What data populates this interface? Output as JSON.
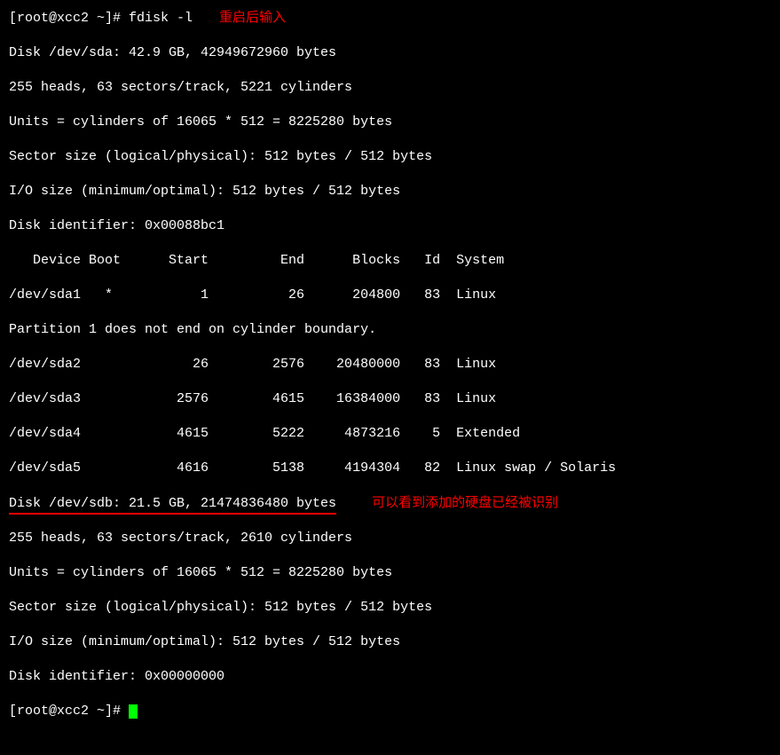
{
  "prompt": {
    "user_host": "[root@xcc2 ~]# ",
    "command": "fdisk -l",
    "annotation1": "重启后输入"
  },
  "disk_sda": {
    "header": "Disk /dev/sda: 42.9 GB, 42949672960 bytes",
    "geometry": "255 heads, 63 sectors/track, 5221 cylinders",
    "units": "Units = cylinders of 16065 * 512 = 8225280 bytes",
    "sector": "Sector size (logical/physical): 512 bytes / 512 bytes",
    "io": "I/O size (minimum/optimal): 512 bytes / 512 bytes",
    "identifier": "Disk identifier: 0x00088bc1"
  },
  "table": {
    "header": "   Device Boot      Start         End      Blocks   Id  System",
    "r0": "/dev/sda1   *           1          26      204800   83  Linux",
    "warn": "Partition 1 does not end on cylinder boundary.",
    "r1": "/dev/sda2              26        2576    20480000   83  Linux",
    "r2": "/dev/sda3            2576        4615    16384000   83  Linux",
    "r3": "/dev/sda4            4615        5222     4873216    5  Extended",
    "r4": "/dev/sda5            4616        5138     4194304   82  Linux swap / Solaris"
  },
  "disk_sdb": {
    "header": "Disk /dev/sdb: 21.5 GB, 21474836480 bytes",
    "annotation2": "可以看到添加的硬盘已经被识别",
    "geometry": "255 heads, 63 sectors/track, 2610 cylinders",
    "units": "Units = cylinders of 16065 * 512 = 8225280 bytes",
    "sector": "Sector size (logical/physical): 512 bytes / 512 bytes",
    "io": "I/O size (minimum/optimal): 512 bytes / 512 bytes",
    "identifier": "Disk identifier: 0x00000000"
  },
  "prompt2": {
    "user_host": "[root@xcc2 ~]# "
  }
}
